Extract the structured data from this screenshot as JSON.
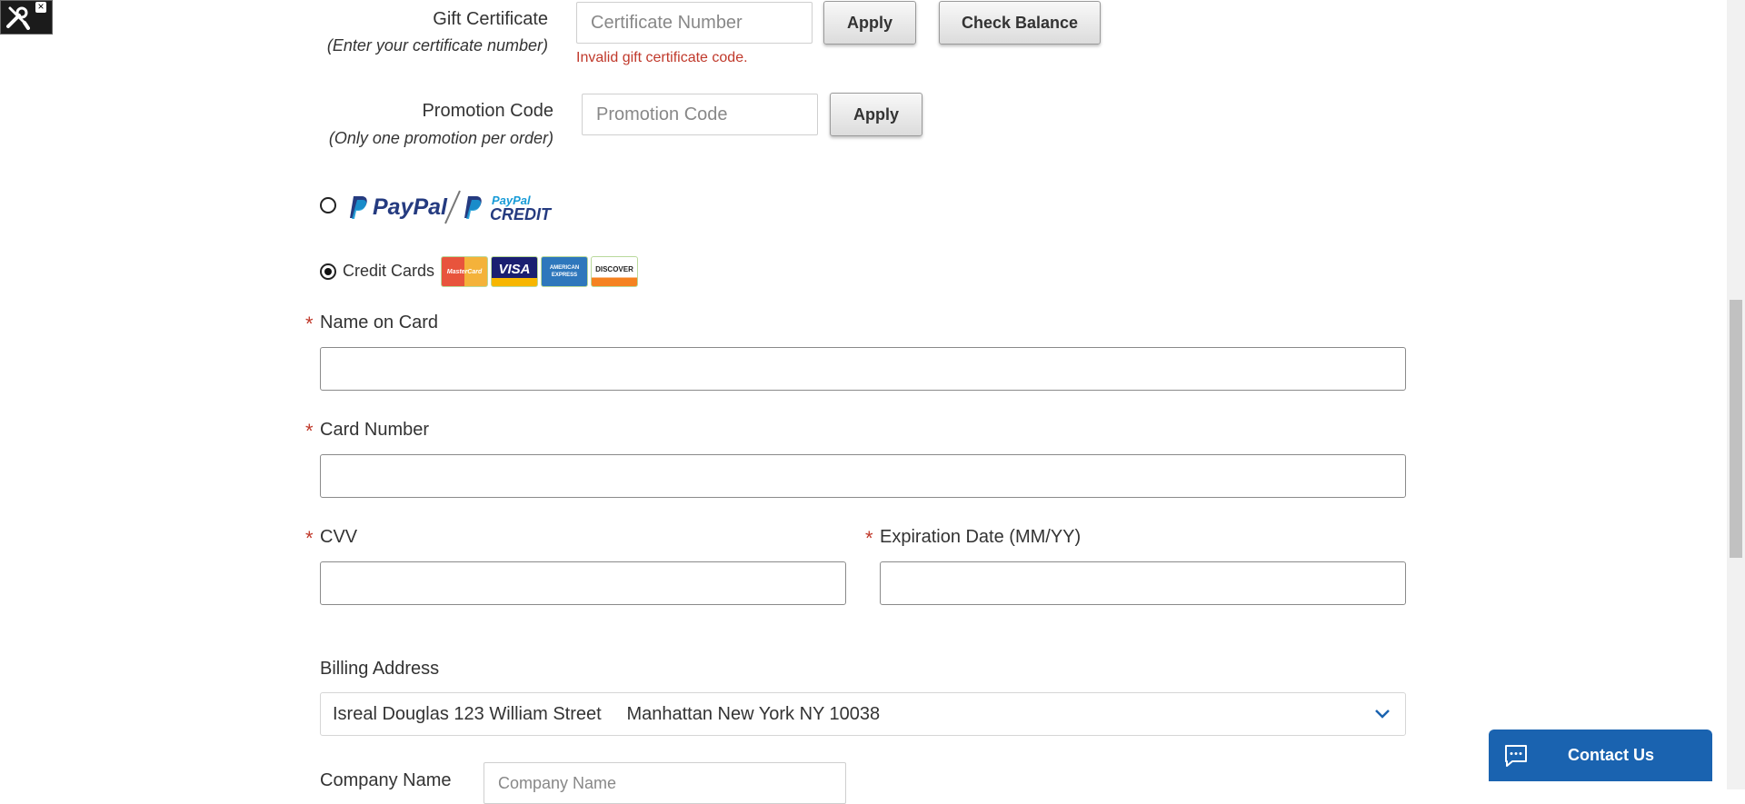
{
  "tools_widget": {
    "icon": "wrench-screwdriver-icon",
    "close": "×"
  },
  "gift_certificate": {
    "label": "Gift Certificate",
    "hint": "(Enter your certificate number)",
    "placeholder": "Certificate Number",
    "value": "",
    "apply_label": "Apply",
    "check_balance_label": "Check Balance",
    "error": "Invalid gift certificate code."
  },
  "promotion": {
    "label": "Promotion Code",
    "hint": "(Only one promotion per order)",
    "placeholder": "Promotion Code",
    "value": "",
    "apply_label": "Apply"
  },
  "payment_methods": {
    "paypal": {
      "selected": false,
      "logo_text": "PayPal",
      "credit_top": "PayPal",
      "credit_bottom": "CREDIT"
    },
    "credit_cards": {
      "selected": true,
      "label": "Credit Cards",
      "cards": [
        {
          "name": "mastercard-icon",
          "text": "MasterCard"
        },
        {
          "name": "visa-icon",
          "text": "VISA"
        },
        {
          "name": "amex-icon",
          "text": "AMERICAN EXPRESS"
        },
        {
          "name": "discover-icon",
          "text": "DISCOVER"
        }
      ]
    }
  },
  "card_form": {
    "required_mark": "*",
    "name_label": "Name on Card",
    "name_value": "",
    "number_label": "Card Number",
    "number_value": "",
    "cvv_label": "CVV",
    "cvv_value": "",
    "expiry_label": "Expiration Date (MM/YY)",
    "expiry_value": ""
  },
  "billing": {
    "label": "Billing Address",
    "selected": "Isreal Douglas 123 William Street     Manhattan New York NY 10038"
  },
  "company": {
    "label": "Company Name",
    "placeholder": "Company Name",
    "value": ""
  },
  "contact_us": {
    "label": "Contact Us",
    "icon": "chat-icon"
  },
  "colors": {
    "error": "#c0392b",
    "contact_bg": "#1a63b0",
    "paypal_dark": "#253b80",
    "paypal_light": "#179bd7"
  }
}
